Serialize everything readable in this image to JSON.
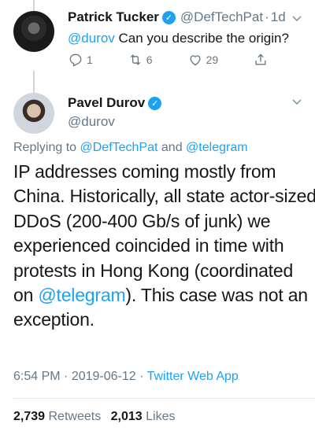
{
  "parent_tweet": {
    "name": "Patrick Tucker",
    "handle": "@DefTechPat",
    "time": "1d",
    "dot": "·",
    "mention": "@durov",
    "text": " Can you describe the origin?",
    "replies": "1",
    "retweets": "6",
    "likes": "29"
  },
  "main_tweet": {
    "name": "Pavel Durov",
    "handle": "@durov",
    "replying_prefix": "Replying to ",
    "replying_to_1": "@DefTechPat",
    "replying_and": " and ",
    "replying_to_2": "@telegram",
    "body_lines": [
      "IP addresses coming mostly from",
      "China. Historically, all state actor-sized",
      "DDoS (200-400 Gb/s of junk) we",
      "experienced coincided in time with",
      "protests in Hong Kong (coordinated",
      "on ",
      "exception."
    ],
    "body_mention": "@telegram",
    "body_line6_rest": "). This case was not an",
    "body_line6_open": "(",
    "time": "6:54 PM",
    "date": "2019-06-12",
    "dot": "·",
    "app": "Twitter Web App"
  },
  "stats": {
    "retweets_count": "2,739",
    "retweets_label": "Retweets",
    "likes_count": "2,013",
    "likes_label": "Likes"
  },
  "colors": {
    "accent": "#1da1f2",
    "secondary_text": "#657786",
    "primary_text": "#14171a"
  },
  "icons": {
    "verified": "verified-badge-icon",
    "reply": "reply-icon",
    "retweet": "retweet-icon",
    "like": "heart-icon",
    "share": "share-icon",
    "more": "chevron-down-icon"
  }
}
